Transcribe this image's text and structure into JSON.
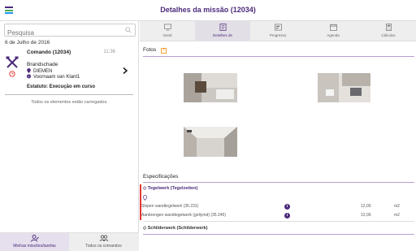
{
  "header": {
    "title": "Detalhes da missão (12034)",
    "menu_icon": "hamburger-icon"
  },
  "search": {
    "placeholder": "Pesquisa"
  },
  "list": {
    "date": "6 de Julho de 2016",
    "card": {
      "title": "Comando (12034)",
      "time": "11:36",
      "subtitle": "Brandschade",
      "location": "DIEMEN",
      "client": "Voornaam van Klant1",
      "status": "Estatuto: Execução em curso"
    },
    "footer_note": "Todos os elementos estão carregados."
  },
  "left_tabs": [
    {
      "label": "Minhas missões/tarefas",
      "icon": "user-tasks-icon",
      "active": true
    },
    {
      "label": "Todos os comandos",
      "icon": "team-icon",
      "active": false
    }
  ],
  "detail_tabs": [
    {
      "label": "Geral",
      "icon": "monitor-icon"
    },
    {
      "label": "Detalhes de",
      "icon": "detail-icon"
    },
    {
      "label": "Progresso",
      "icon": "progress-icon"
    },
    {
      "label": "Agenda",
      "icon": "calendar-icon"
    },
    {
      "label": "Cálculos",
      "icon": "calculator-icon"
    }
  ],
  "photos": {
    "title": "Fotos",
    "add_label": "+"
  },
  "specs": {
    "title": "Especificações",
    "groups": [
      {
        "name": "Tegelwerk (Tegelzetten)",
        "rows": [
          {
            "desc": "Slopen wandtegelwerk (35.231)",
            "value": "12,00",
            "unit": "m2"
          },
          {
            "desc": "Aanbrengen wandtegelwerk (geliymd) (35.245)",
            "value": "12,00",
            "unit": "m2"
          }
        ]
      },
      {
        "name": "Schilderwerk (Schilderwerk)",
        "rows": []
      }
    ]
  },
  "colors": {
    "accent": "#4b2a7b",
    "alert": "#e53935",
    "plus": "#f2a33a"
  }
}
